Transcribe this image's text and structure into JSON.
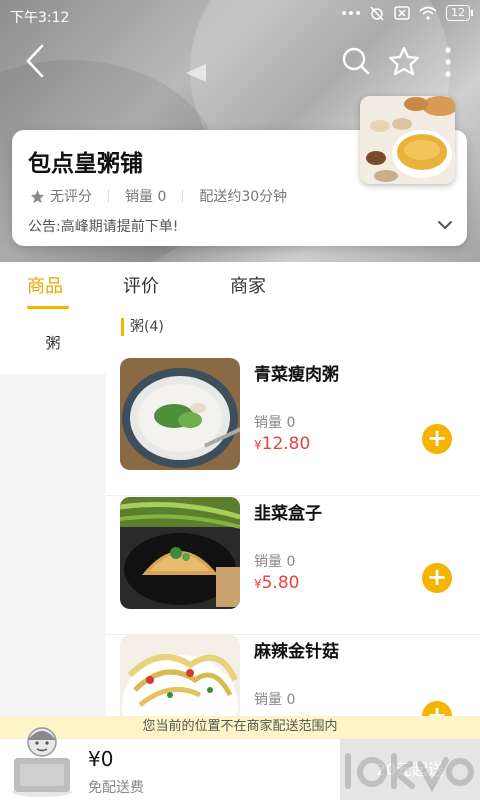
{
  "status_bar": {
    "time": "下午3:12",
    "battery": "12"
  },
  "shop": {
    "name": "包点皇粥铺",
    "rating": "无评分",
    "sales": "销量 0",
    "delivery": "配送约30分钟",
    "notice": "公告:高峰期请提前下单!"
  },
  "tabs": [
    "商品",
    "评价",
    "商家"
  ],
  "sidebar": {
    "items": [
      {
        "label": "粥"
      }
    ]
  },
  "section_title": "粥(4)",
  "products": [
    {
      "name": "青菜瘦肉粥",
      "sales": "销量 0",
      "currency": "¥",
      "price": "12.80"
    },
    {
      "name": "韭菜盒子",
      "sales": "销量 0",
      "currency": "¥",
      "price": "5.80"
    },
    {
      "name": "麻辣金针菇",
      "sales": "销量 0"
    }
  ],
  "range_notice": "您当前的位置不在商家配送范围内",
  "cart": {
    "total": "¥0",
    "delivery_fee": "免配送费",
    "checkout": "20元起送"
  },
  "colors": {
    "accent": "#f5b400",
    "price": "#e64340",
    "tab_active": "#e9a400"
  },
  "icons": [
    "back-icon",
    "search-icon",
    "star-icon",
    "more-icon",
    "chevron-down-icon",
    "add-icon",
    "cart-icon"
  ]
}
